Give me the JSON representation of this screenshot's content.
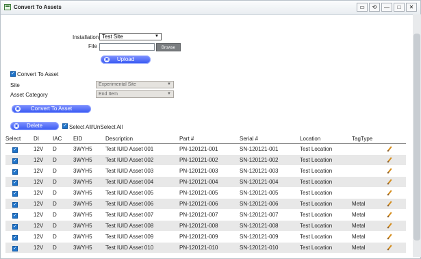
{
  "window": {
    "title": "Convert To Assets",
    "controls": [
      "▭",
      "⟲",
      "—",
      "□",
      "✕"
    ]
  },
  "upload": {
    "installation_label": "Installation :",
    "installation_value": "Test Site",
    "file_label": "File :",
    "file_value": "",
    "browse_label": "Browse",
    "upload_label": "Upload"
  },
  "convert": {
    "checkbox_label": "Convert To Asset",
    "site_label": "Site",
    "site_value": "Experimental Site",
    "category_label": "Asset Category",
    "category_value": "End Item",
    "button_label": "Convert To Asset"
  },
  "actions": {
    "delete_label": "Delete",
    "select_all_label": "Select All/UnSelect All"
  },
  "table": {
    "headers": [
      "Select",
      "DI",
      "IAC",
      "EID",
      "Description",
      "Part #",
      "Serial #",
      "Location",
      "TagType",
      ""
    ],
    "rows": [
      {
        "di": "12V",
        "iac": "D",
        "eid": "3WYH5",
        "description": "Test IUID Asset 001",
        "part": "PN-120121-001",
        "serial": "SN-120121-001",
        "location": "Test Location",
        "tagtype": ""
      },
      {
        "di": "12V",
        "iac": "D",
        "eid": "3WYH5",
        "description": "Test IUID Asset 002",
        "part": "PN-120121-002",
        "serial": "SN-120121-002",
        "location": "Test Location",
        "tagtype": ""
      },
      {
        "di": "12V",
        "iac": "D",
        "eid": "3WYH5",
        "description": "Test IUID Asset 003",
        "part": "PN-120121-003",
        "serial": "SN-120121-003",
        "location": "Test Location",
        "tagtype": ""
      },
      {
        "di": "12V",
        "iac": "D",
        "eid": "3WYH5",
        "description": "Test IUID Asset 004",
        "part": "PN-120121-004",
        "serial": "SN-120121-004",
        "location": "Test Location",
        "tagtype": ""
      },
      {
        "di": "12V",
        "iac": "D",
        "eid": "3WYH5",
        "description": "Test IUID Asset 005",
        "part": "PN-120121-005",
        "serial": "SN-120121-005",
        "location": "Test Location",
        "tagtype": ""
      },
      {
        "di": "12V",
        "iac": "D",
        "eid": "3WYH5",
        "description": "Test IUID Asset 006",
        "part": "PN-120121-006",
        "serial": "SN-120121-006",
        "location": "Test Location",
        "tagtype": "Metal"
      },
      {
        "di": "12V",
        "iac": "D",
        "eid": "3WYH5",
        "description": "Test IUID Asset 007",
        "part": "PN-120121-007",
        "serial": "SN-120121-007",
        "location": "Test Location",
        "tagtype": "Metal"
      },
      {
        "di": "12V",
        "iac": "D",
        "eid": "3WYH5",
        "description": "Test IUID Asset 008",
        "part": "PN-120121-008",
        "serial": "SN-120121-008",
        "location": "Test Location",
        "tagtype": "Metal"
      },
      {
        "di": "12V",
        "iac": "D",
        "eid": "3WYH5",
        "description": "Test IUID Asset 009",
        "part": "PN-120121-009",
        "serial": "SN-120121-009",
        "location": "Test Location",
        "tagtype": "Metal"
      },
      {
        "di": "12V",
        "iac": "D",
        "eid": "3WYH5",
        "description": "Test IUID Asset 010",
        "part": "PN-120121-010",
        "serial": "SN-120121-010",
        "location": "Test Location",
        "tagtype": "Metal"
      }
    ]
  },
  "colors": {
    "accent_blue": "#3658f2",
    "checkbox_blue": "#1e73c9",
    "edit_orange": "#d48a16"
  },
  "icons": {
    "app": "window-app-icon",
    "upload": "upload-icon",
    "edit": "edit-icon"
  }
}
